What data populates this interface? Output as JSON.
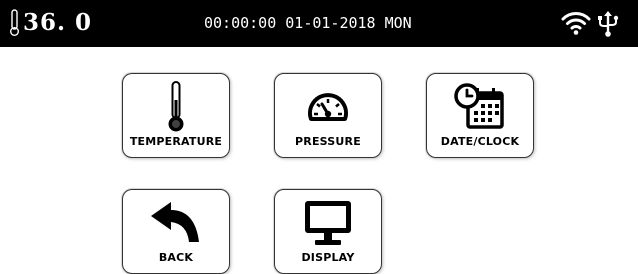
{
  "status_bar": {
    "temperature": "36. 0",
    "datetime": "00:00:00 01-01-2018 MON",
    "icons": [
      "thermometer-icon",
      "wifi-icon",
      "usb-icon"
    ]
  },
  "menu": {
    "tiles": [
      {
        "label": "TEMPERATURE",
        "icon": "thermometer-icon"
      },
      {
        "label": "PRESSURE",
        "icon": "gauge-icon"
      },
      {
        "label": "DATE/CLOCK",
        "icon": "calendar-clock-icon"
      },
      {
        "label": "BACK",
        "icon": "back-arrow-icon"
      },
      {
        "label": "DISPLAY",
        "icon": "monitor-icon"
      }
    ]
  },
  "colors": {
    "status_bar_bg": "#000000",
    "status_text": "#ffffff",
    "tile_border": "#333333"
  }
}
